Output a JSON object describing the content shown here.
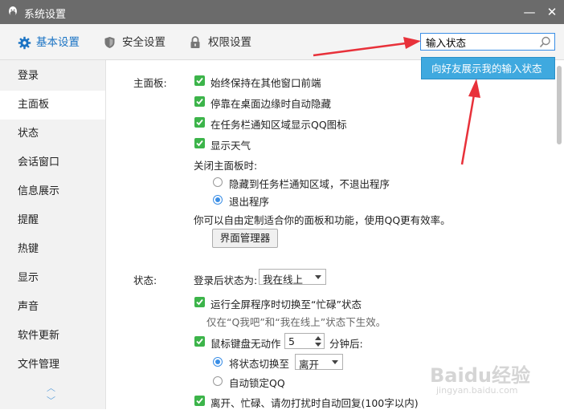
{
  "window": {
    "title": "系统设置",
    "minimize_glyph": "—",
    "close_glyph": "✕"
  },
  "toolbar": {
    "tabs": [
      {
        "label": "基本设置",
        "icon": "gear-icon",
        "active": true
      },
      {
        "label": "安全设置",
        "icon": "shield-icon",
        "active": false
      },
      {
        "label": "权限设置",
        "icon": "lock-icon",
        "active": false
      }
    ],
    "search": {
      "value": "输入状态",
      "placeholder": ""
    }
  },
  "suggestion": {
    "label": "向好友展示我的输入状态"
  },
  "sidebar": {
    "items": [
      {
        "label": "登录",
        "active": false
      },
      {
        "label": "主面板",
        "active": true
      },
      {
        "label": "状态",
        "active": false
      },
      {
        "label": "会话窗口",
        "active": false
      },
      {
        "label": "信息展示",
        "active": false
      },
      {
        "label": "提醒",
        "active": false
      },
      {
        "label": "热键",
        "active": false
      },
      {
        "label": "显示",
        "active": false
      },
      {
        "label": "声音",
        "active": false
      },
      {
        "label": "软件更新",
        "active": false
      },
      {
        "label": "文件管理",
        "active": false
      }
    ],
    "scroll_up_glyph": "︿",
    "scroll_down_glyph": "﹀"
  },
  "main_panel": {
    "section_label": "主面板:",
    "checkboxes": [
      {
        "label": "始终保持在其他窗口前端",
        "checked": true
      },
      {
        "label": "停靠在桌面边缘时自动隐藏",
        "checked": true
      },
      {
        "label": "在任务栏通知区域显示QQ图标",
        "checked": true
      },
      {
        "label": "显示天气",
        "checked": true
      }
    ],
    "close_label": "关闭主面板时:",
    "close_options": [
      {
        "label": "隐藏到任务栏通知区域，不退出程序",
        "selected": false
      },
      {
        "label": "退出程序",
        "selected": true
      }
    ],
    "customize_text": "你可以自由定制适合你的面板和功能，使用QQ更有效率。",
    "manager_button": "界面管理器"
  },
  "status": {
    "section_label": "状态:",
    "after_login_label": "登录后状态为:",
    "after_login_value": "我在线上",
    "fullscreen_busy": {
      "label": "运行全屏程序时切换至“忙碌”状态",
      "checked": true
    },
    "fullscreen_hint": "仅在“Q我吧”和“我在线上”状态下生效。",
    "idle": {
      "label": "鼠标键盘无动作",
      "checked": true,
      "minutes": "5",
      "suffix": "分钟后:"
    },
    "idle_options": [
      {
        "label": "将状态切换至",
        "selected": true
      },
      {
        "label": "自动锁定QQ",
        "selected": false
      }
    ],
    "idle_switch_value": "离开",
    "auto_reply": {
      "label": "离开、忙碌、请勿打扰时自动回复(100字以内)",
      "checked": true
    }
  },
  "watermark": {
    "text": "Baidu经验",
    "subtext": "jingyan.baidu.com"
  },
  "colors": {
    "accent": "#3a8ee6",
    "check_green": "#3cb44a",
    "annotation_red": "#e8313a",
    "titlebar": "#6b6b6b"
  }
}
